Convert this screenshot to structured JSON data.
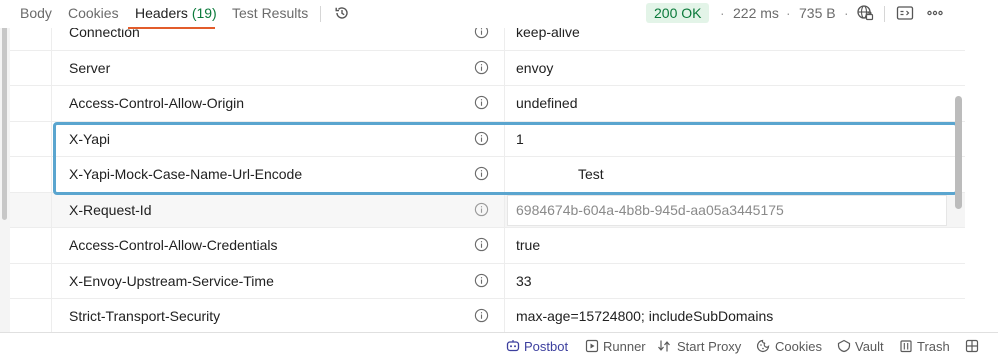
{
  "tabs": [
    {
      "label": "Body"
    },
    {
      "label": "Cookies"
    },
    {
      "label": "Headers",
      "count": "(19)"
    },
    {
      "label": "Test Results"
    }
  ],
  "response": {
    "status": "200 OK",
    "time": "222 ms",
    "size": "735 B",
    "dot": "·"
  },
  "headers": [
    {
      "key": "Connection",
      "value": "keep-alive"
    },
    {
      "key": "Server",
      "value": "envoy"
    },
    {
      "key": "Access-Control-Allow-Origin",
      "value": "undefined"
    },
    {
      "key": "X-Yapi",
      "value": "1"
    },
    {
      "key": "X-Yapi-Mock-Case-Name-Url-Encode",
      "value": "Test"
    },
    {
      "key": "X-Request-Id",
      "value": "6984674b-604a-4b8b-945d-aa05a3445175"
    },
    {
      "key": "Access-Control-Allow-Credentials",
      "value": "true"
    },
    {
      "key": "X-Envoy-Upstream-Service-Time",
      "value": "33"
    },
    {
      "key": "Strict-Transport-Security",
      "value": "max-age=15724800; includeSubDomains"
    }
  ],
  "footer": {
    "postbot": "Postbot",
    "runner": "Runner",
    "start_proxy": "Start Proxy",
    "cookies": "Cookies",
    "vault": "Vault",
    "trash": "Trash"
  },
  "colors": {
    "accent": "#e25c2b",
    "status_green": "#0b7a3b",
    "highlight": "#5aa5cf"
  }
}
